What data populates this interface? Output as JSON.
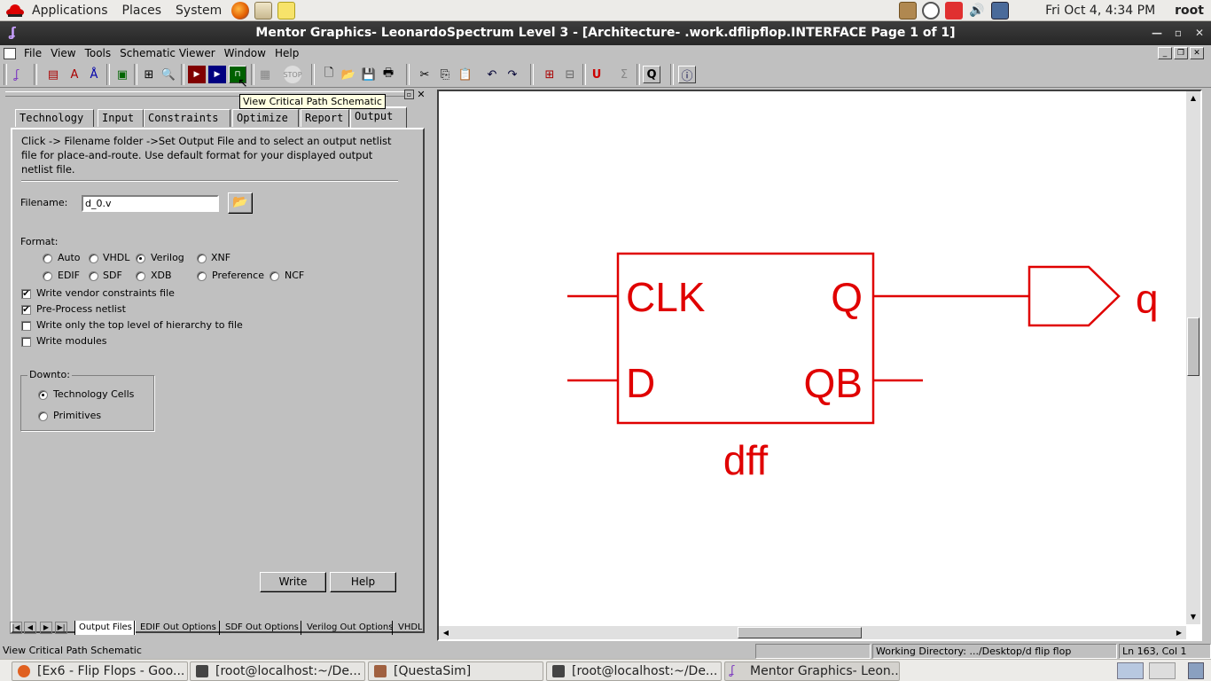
{
  "top_panel": {
    "menus": [
      "Applications",
      "Places",
      "System"
    ],
    "clock": "Fri Oct  4,  4:34 PM",
    "user": "root"
  },
  "window": {
    "title": "Mentor Graphics- LeonardoSpectrum Level 3 - [Architecture- .work.dflipflop.INTERFACE Page 1 of 1]"
  },
  "menubar": [
    "File",
    "View",
    "Tools",
    "Schematic Viewer",
    "Window",
    "Help"
  ],
  "tooltip": "View Critical Path Schematic",
  "tabs": [
    "Technology",
    "Input",
    "Constraints",
    "Optimize",
    "Report",
    "Output"
  ],
  "output": {
    "description": "Click -> Filename folder ->Set Output File and to select an  output netlist file for place-and-route. Use default format for  your displayed output netlist file.",
    "filename_label": "Filename:",
    "filename_value": "d_0.v",
    "format_label": "Format:",
    "formats": [
      "Auto",
      "VHDL",
      "Verilog",
      "XNF",
      "EDIF",
      "SDF",
      "XDB",
      "Preference",
      "NCF"
    ],
    "selected_format": "Verilog",
    "checks": [
      {
        "label": "Write vendor constraints file",
        "checked": true
      },
      {
        "label": "Pre-Process netlist",
        "checked": true
      },
      {
        "label": "Write only the top level of hierarchy to file",
        "checked": false
      },
      {
        "label": "Write modules",
        "checked": false
      }
    ],
    "downto_label": "Downto:",
    "downto_options": [
      "Technology Cells",
      "Primitives"
    ],
    "downto_selected": "Technology Cells",
    "write_button": "Write",
    "help_button": "Help"
  },
  "bottom_tabs": [
    "Output Files",
    "EDIF Out Options",
    "SDF Out Options",
    "Verilog Out Options",
    "VHDL"
  ],
  "schematic": {
    "block_name": "dff",
    "pins_left": [
      "CLK",
      "D"
    ],
    "pins_right": [
      "Q",
      "QB"
    ],
    "output_port": "q",
    "color": "#e00000"
  },
  "status": {
    "message": "View Critical Path Schematic",
    "working_dir": "Working Directory: .../Desktop/d flip flop",
    "position": "Ln 163, Col 1"
  },
  "taskbar": [
    {
      "label": "[Ex6 - Flip Flops - Goo...",
      "active": false
    },
    {
      "label": "[root@localhost:~/De...",
      "active": false
    },
    {
      "label": "[QuestaSim]",
      "active": false
    },
    {
      "label": "[root@localhost:~/De...",
      "active": false
    },
    {
      "label": "Mentor Graphics- Leon...",
      "active": true
    }
  ]
}
